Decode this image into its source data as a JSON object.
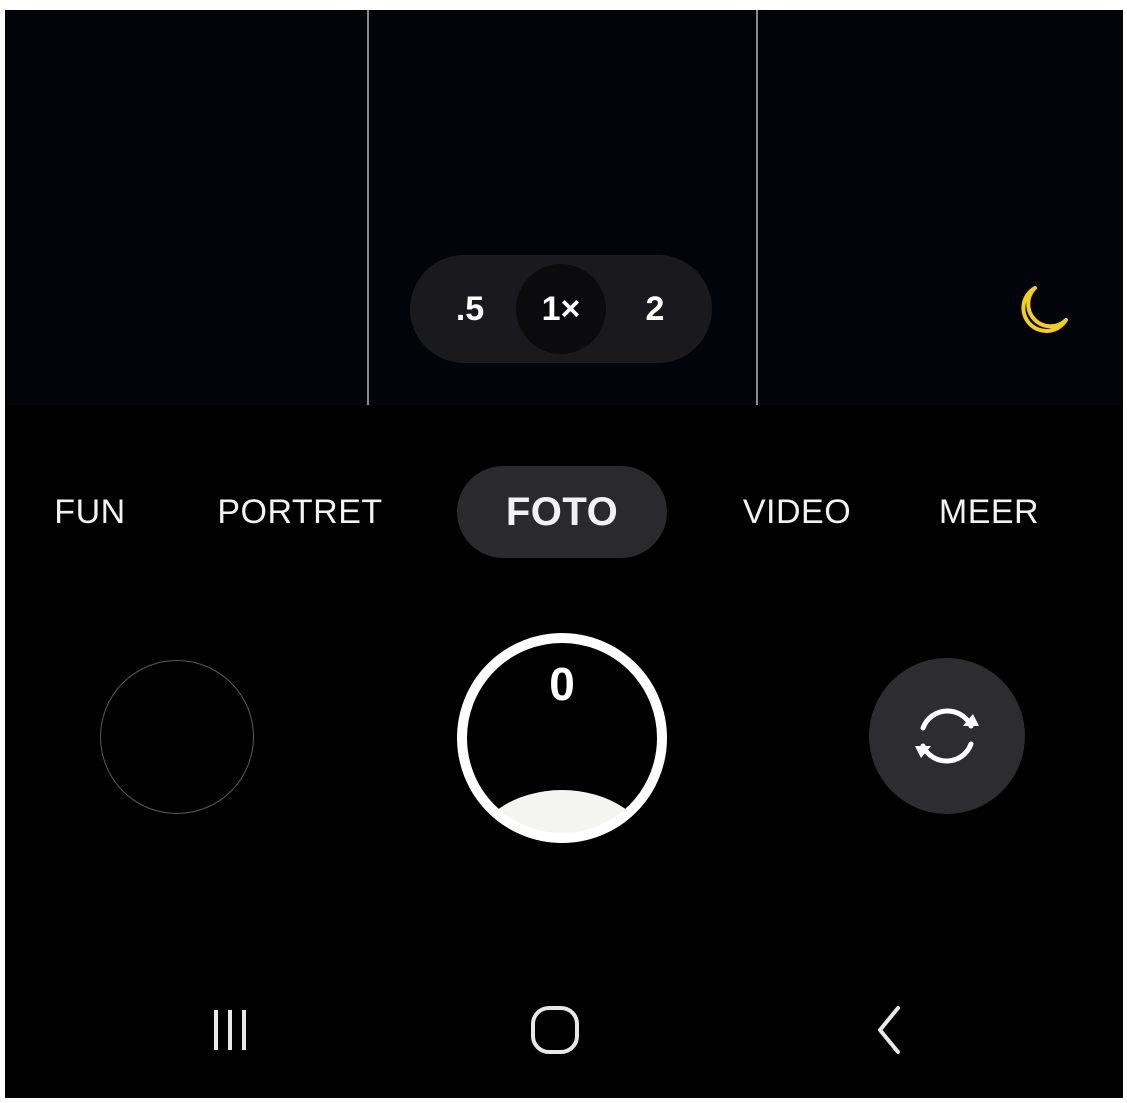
{
  "zoom": {
    "options": [
      ".5",
      "1×",
      "2"
    ],
    "selected": "1×"
  },
  "night_mode": {
    "icon": "moon-icon",
    "color": "#f2cf1f"
  },
  "modes": {
    "items": [
      "FUN",
      "PORTRET",
      "FOTO",
      "VIDEO",
      "MEER"
    ],
    "selected": "FOTO"
  },
  "shutter": {
    "count": "0",
    "icon": "shutter-button"
  },
  "gallery": {
    "icon": "gallery-thumbnail"
  },
  "camera_switch": {
    "icon": "rotate-camera-icon"
  },
  "navigation": {
    "recents_icon": "recents-icon",
    "home_icon": "home-icon",
    "back_icon": "back-icon"
  },
  "colors": {
    "background": "#000000",
    "selected_pill": "#2a2a2c",
    "text": "#f2f2f2"
  }
}
